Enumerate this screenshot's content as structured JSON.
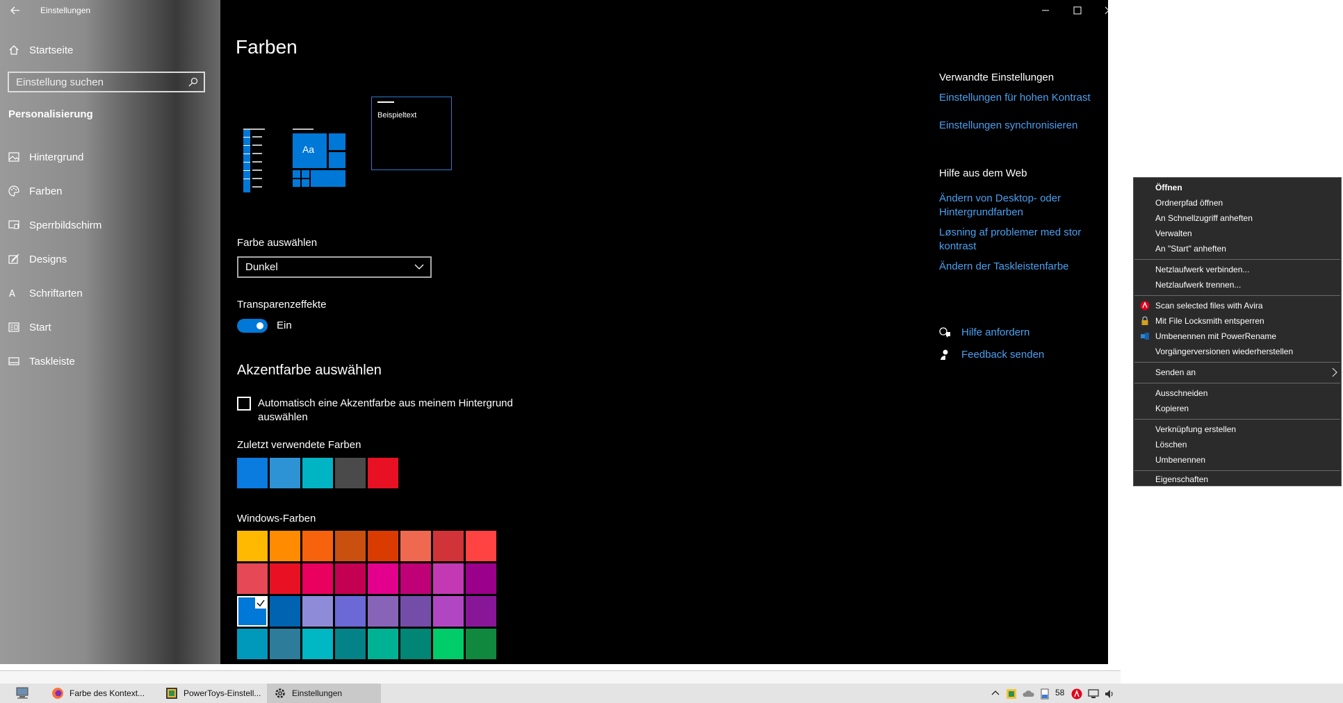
{
  "window": {
    "title": "Einstellungen",
    "sidebar": {
      "home_label": "Startseite",
      "search_placeholder": "Einstellung suchen",
      "section": "Personalisierung",
      "items": [
        {
          "label": "Hintergrund",
          "icon": "image-icon"
        },
        {
          "label": "Farben",
          "icon": "palette-icon"
        },
        {
          "label": "Sperrbildschirm",
          "icon": "lockscreen-icon"
        },
        {
          "label": "Designs",
          "icon": "brush-icon"
        },
        {
          "label": "Schriftarten",
          "icon": "font-icon"
        },
        {
          "label": "Start",
          "icon": "start-icon"
        },
        {
          "label": "Taskleiste",
          "icon": "taskbar-icon"
        }
      ]
    },
    "main": {
      "title": "Farben",
      "preview_sample_text": "Beispieltext",
      "preview_tile_text": "Aa",
      "color_select_label": "Farbe auswählen",
      "color_select_value": "Dunkel",
      "transparency_label": "Transparenzeffekte",
      "transparency_value": "Ein",
      "accent_heading": "Akzentfarbe auswählen",
      "auto_accent_label": "Automatisch eine Akzentfarbe aus meinem Hintergrund auswählen",
      "recent_colors_label": "Zuletzt verwendete Farben",
      "recent_colors": [
        "#0a7ce0",
        "#2e93d5",
        "#00b4c4",
        "#4a4a4a",
        "#e81123"
      ],
      "windows_colors_label": "Windows-Farben",
      "windows_colors": [
        "#ffb900",
        "#ff8c00",
        "#f7630c",
        "#ca5010",
        "#da3b01",
        "#ef6950",
        "#d13438",
        "#ff4343",
        "#e74856",
        "#e81123",
        "#ea005e",
        "#c30052",
        "#e3008c",
        "#bf0077",
        "#c239b3",
        "#9a0089",
        "#0078d7",
        "#0063b1",
        "#8e8cd8",
        "#6b69d6",
        "#8764b8",
        "#744da9",
        "#b146c2",
        "#881798",
        "#0099bc",
        "#2d7d9a",
        "#00b7c3",
        "#038387",
        "#00b294",
        "#018574",
        "#00cc6a",
        "#10893e"
      ],
      "selected_color_index": 16
    },
    "related": {
      "heading": "Verwandte Einstellungen",
      "links": [
        "Einstellungen für hohen Kontrast",
        "Einstellungen synchronisieren"
      ]
    },
    "web_help": {
      "heading": "Hilfe aus dem Web",
      "links": [
        "Ändern von Desktop- oder Hintergrundfarben",
        "Løsning af problemer med stor kontrast",
        "Ändern der Taskleistenfarbe"
      ]
    },
    "support": {
      "help_label": "Hilfe anfordern",
      "feedback_label": "Feedback senden"
    }
  },
  "context_menu": {
    "items": [
      {
        "label": "Öffnen",
        "bold": true
      },
      {
        "label": "Ordnerpfad öffnen"
      },
      {
        "label": "An Schnellzugriff anheften"
      },
      {
        "label": "Verwalten"
      },
      {
        "label": "An \"Start\" anheften"
      },
      {
        "label": "Netzlaufwerk verbinden..."
      },
      {
        "label": "Netzlaufwerk trennen..."
      },
      {
        "label": "Scan selected files with Avira",
        "icon": "avira-icon"
      },
      {
        "label": "Mit File Locksmith entsperren",
        "icon": "lock-icon"
      },
      {
        "label": "Umbenennen mit PowerRename",
        "icon": "powerrename-icon"
      },
      {
        "label": "Vorgängerversionen wiederherstellen"
      },
      {
        "label": "Senden an",
        "submenu": true
      },
      {
        "label": "Ausschneiden"
      },
      {
        "label": "Kopieren"
      },
      {
        "label": "Verknüpfung erstellen"
      },
      {
        "label": "Löschen"
      },
      {
        "label": "Umbenennen"
      },
      {
        "label": "Eigenschaften"
      }
    ]
  },
  "taskbar": {
    "apps": [
      {
        "label": "Farbe des Kontext...",
        "icon": "firefox-icon"
      },
      {
        "label": "PowerToys-Einstell...",
        "icon": "powertoys-icon"
      },
      {
        "label": "Einstellungen",
        "icon": "gear-icon",
        "active": true
      }
    ],
    "tray_number": "58"
  }
}
